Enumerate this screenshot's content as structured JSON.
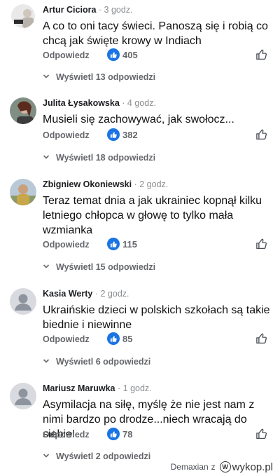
{
  "comments": [
    {
      "author": "Artur Ciciora",
      "separator": "·",
      "time": "3 godz.",
      "text": "A co to oni tacy świeci. Panoszą się i robią co chcą jak święte krowy w Indiach",
      "reply_label": "Odpowiedz",
      "likes": "405",
      "replies_label": "Wyświetl 13 odpowiedzi"
    },
    {
      "author": "Julita Łysakowska",
      "separator": "·",
      "time": "4 godz.",
      "text": "Musieli się zachowywać, jak swołocz...",
      "reply_label": "Odpowiedz",
      "likes": "382",
      "replies_label": "Wyświetl 18 odpowiedzi"
    },
    {
      "author": "Zbigniew Okoniewski",
      "separator": "·",
      "time": "2 godz.",
      "text": "Teraz temat dnia a jak ukrainiec kopnął kilku letniego chłopca w głowę to tylko mała wzmianka",
      "reply_label": "Odpowiedz",
      "likes": "115",
      "replies_label": "Wyświetl 15 odpowiedzi"
    },
    {
      "author": "Kasia Werty",
      "separator": "·",
      "time": "2 godz.",
      "text": "Ukraińskie dzieci w polskich szkołach są takie biednie i niewinne",
      "reply_label": "Odpowiedz",
      "likes": "85",
      "replies_label": "Wyświetl 6 odpowiedzi"
    },
    {
      "author": "Mariusz Maruwka",
      "separator": "·",
      "time": "1 godz.",
      "text": "Asymilacja na siłę, myślę że nie jest nam z nimi bardzo po drodze...niech wracają do siebie!",
      "reply_label": "Odpowiedz",
      "likes": "78",
      "replies_label": "Wyświetl 2 odpowiedzi"
    }
  ],
  "watermark": {
    "user": "Demaxian",
    "via": "z",
    "site": "wykop.pl",
    "logo_letter": "W"
  },
  "icons": {
    "like_badge": "thumbs-up-filled-icon",
    "like_button": "thumbs-up-outline-icon",
    "expand": "chevron-down-icon"
  },
  "colors": {
    "like_blue": "#1b74e4",
    "secondary_text": "#65676b",
    "timestamp": "#8a8d91"
  }
}
